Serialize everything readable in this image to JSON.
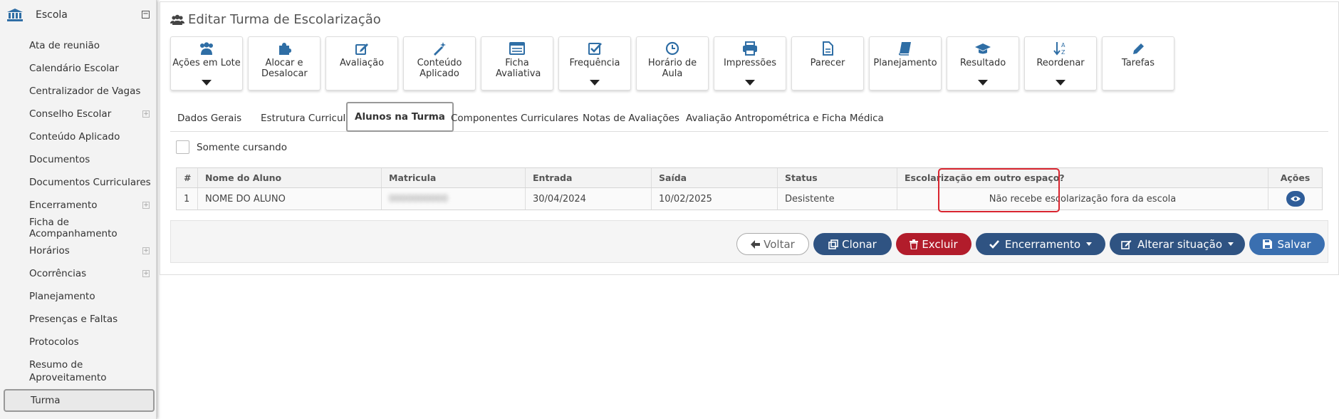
{
  "sidebar": {
    "header": "Escola",
    "collapse_symbol": "⊟",
    "items": [
      {
        "label": "Ata de reunião",
        "expandable": false
      },
      {
        "label": "Calendário Escolar",
        "expandable": false
      },
      {
        "label": "Centralizador de Vagas",
        "expandable": false
      },
      {
        "label": "Conselho Escolar",
        "expandable": true
      },
      {
        "label": "Conteúdo Aplicado",
        "expandable": false
      },
      {
        "label": "Documentos",
        "expandable": false
      },
      {
        "label": "Documentos Curriculares",
        "expandable": false
      },
      {
        "label": "Encerramento",
        "expandable": true
      },
      {
        "label": "Ficha de Acompanhamento",
        "expandable": false
      },
      {
        "label": "Horários",
        "expandable": true
      },
      {
        "label": "Ocorrências",
        "expandable": true
      },
      {
        "label": "Planejamento",
        "expandable": false
      },
      {
        "label": "Presenças e Faltas",
        "expandable": false
      },
      {
        "label": "Protocolos",
        "expandable": false
      },
      {
        "label": "Resumo de Aproveitamento",
        "expandable": false
      },
      {
        "label": "Turma",
        "expandable": false,
        "active": true
      }
    ]
  },
  "page": {
    "title": "Editar Turma de Escolarização"
  },
  "toolbar": [
    {
      "label": "Ações em Lote",
      "icon": "users-icon",
      "caret": true
    },
    {
      "label": "Alocar e Desalocar",
      "icon": "puzzle-icon",
      "caret": false
    },
    {
      "label": "Avaliação",
      "icon": "edit-icon",
      "caret": false
    },
    {
      "label": "Conteúdo Aplicado",
      "icon": "magic-wand-icon",
      "caret": false
    },
    {
      "label": "Ficha Avaliativa",
      "icon": "list-icon",
      "caret": false
    },
    {
      "label": "Frequência",
      "icon": "check-square-icon",
      "caret": true
    },
    {
      "label": "Horário de Aula",
      "icon": "clock-icon",
      "caret": false
    },
    {
      "label": "Impressões",
      "icon": "printer-icon",
      "caret": true
    },
    {
      "label": "Parecer",
      "icon": "file-icon",
      "caret": false
    },
    {
      "label": "Planejamento",
      "icon": "book-icon",
      "caret": false
    },
    {
      "label": "Resultado",
      "icon": "graduation-cap-icon",
      "caret": true
    },
    {
      "label": "Reordenar",
      "icon": "sort-alpha-icon",
      "caret": true
    },
    {
      "label": "Tarefas",
      "icon": "pencil-icon",
      "caret": false
    }
  ],
  "tabs": [
    {
      "label": "Dados Gerais",
      "active": false
    },
    {
      "label": "Estrutura Curricular",
      "active": false
    },
    {
      "label": "Alunos na Turma",
      "active": true
    },
    {
      "label": "Componentes Curriculares",
      "active": false
    },
    {
      "label": "Notas de Avaliações",
      "active": false
    },
    {
      "label": "Avaliação Antropométrica e Ficha Médica",
      "active": false
    }
  ],
  "filter": {
    "checkbox_label": "Somente cursando",
    "checked": false
  },
  "table": {
    "columns": [
      "#",
      "Nome do Aluno",
      "Matricula",
      "Entrada",
      "Saída",
      "Status",
      "Escolarização em outro espaço?",
      "Ações"
    ],
    "rows": [
      {
        "num": "1",
        "nome": "NOME DO ALUNO",
        "matricula": "0000000000",
        "entrada": "30/04/2024",
        "saida": "10/02/2025",
        "status": "Desistente",
        "escolarizacao": "Não recebe escolarização fora da escola"
      }
    ]
  },
  "actions": {
    "voltar": "Voltar",
    "clonar": "Clonar",
    "excluir": "Excluir",
    "encerramento": "Encerramento",
    "alterar_situacao": "Alterar situação",
    "salvar": "Salvar"
  },
  "colors": {
    "primary": "#2f5382",
    "danger": "#b21c2b",
    "save": "#3a6fb0",
    "icon_blue": "#2f6ea5",
    "highlight": "#d9252f"
  }
}
